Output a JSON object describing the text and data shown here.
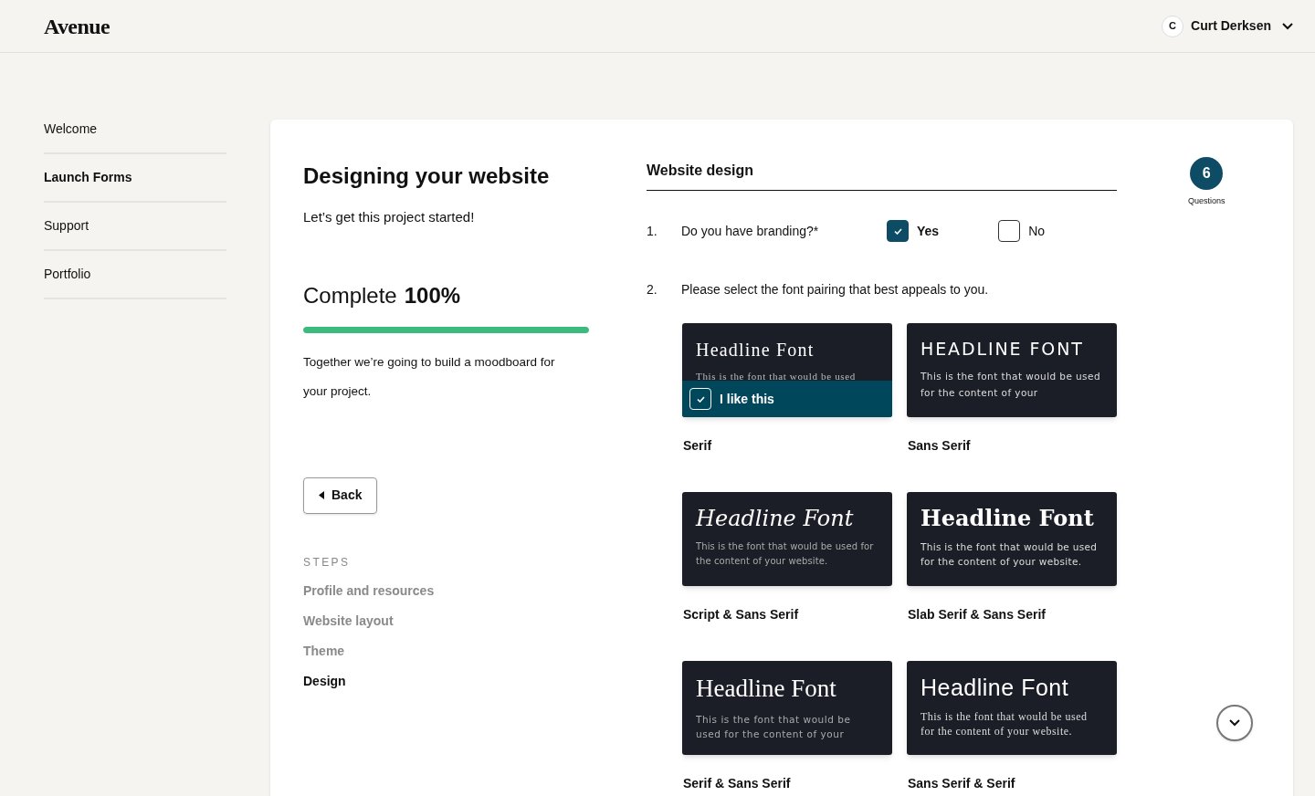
{
  "header": {
    "logo": "Avenue",
    "user": {
      "initial": "C",
      "name": "Curt Derksen"
    }
  },
  "sidebar": {
    "items": [
      {
        "label": "Welcome",
        "selected": false
      },
      {
        "label": "Launch Forms",
        "selected": true
      },
      {
        "label": "Support",
        "selected": false
      },
      {
        "label": "Portfolio",
        "selected": false
      }
    ]
  },
  "intro": {
    "title": "Designing your website",
    "subtitle": "Let’s get this project started!",
    "complete_label": "Complete",
    "complete_value": "100%",
    "level": 1,
    "description": "Together we’re going to build a moodboard for your project.",
    "back_button": "Back"
  },
  "steps": {
    "heading": "STEPS",
    "items": [
      {
        "label": "Profile and resources",
        "selected": false
      },
      {
        "label": "Website layout",
        "selected": false
      },
      {
        "label": "Theme",
        "selected": false
      },
      {
        "label": "Design",
        "selected": true
      }
    ]
  },
  "form": {
    "title": "Website design",
    "question_count": "6",
    "question_count_label": "Questions",
    "questions": [
      {
        "kind": "checkboxes",
        "number": "1.",
        "text": "Do you have branding?*",
        "options": [
          {
            "label": "Yes",
            "checked": true
          },
          {
            "label": "No",
            "checked": false
          }
        ]
      },
      {
        "kind": "font-cards",
        "number": "2.",
        "text": "Please select the font pairing that best appeals to you.",
        "cards": [
          {
            "headline": "Headline Font",
            "body": "This is the font that would be used",
            "label": "Serif",
            "selected": true,
            "like_label": "I like this"
          },
          {
            "headline": "HEADLINE FONT",
            "body": "This is the font that would be used for the content of your",
            "label": "Sans Serif",
            "selected": false
          },
          {
            "headline": "Headline Font",
            "body": "This is the font that would be used for the content of your website.",
            "label": "Script & Sans Serif",
            "selected": false
          },
          {
            "headline": "Headline Font",
            "body": "This is the font that would be used for the content of your website.",
            "label": "Slab Serif & Sans Serif",
            "selected": false
          },
          {
            "headline": "Headline Font",
            "body": "This is the font that would be used for the content of your",
            "label": "Serif & Sans Serif",
            "selected": false
          },
          {
            "headline": "Headline Font",
            "body": "This is the font that would be used for the content of your website.",
            "label": "Sans Serif & Serif",
            "selected": false
          }
        ]
      }
    ]
  }
}
